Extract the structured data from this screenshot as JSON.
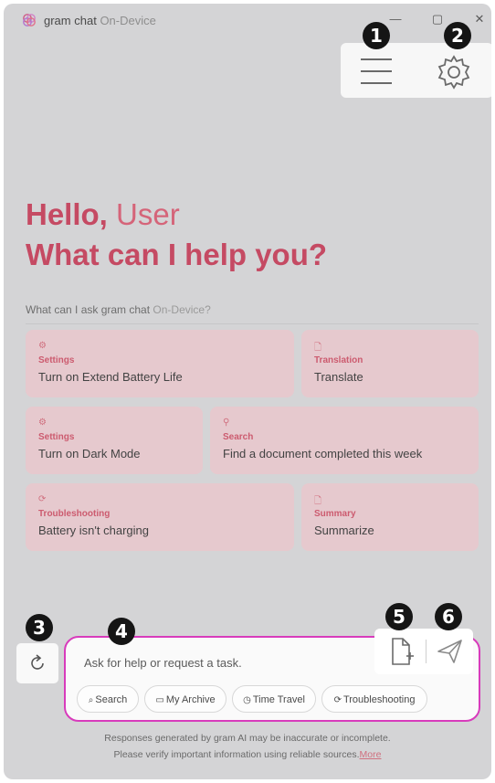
{
  "titlebar": {
    "app_name": "gram chat",
    "app_sub": "On-Device",
    "minimize": "—",
    "maximize": "▢",
    "close": "✕"
  },
  "callouts": [
    "1",
    "2",
    "3",
    "4",
    "5",
    "6"
  ],
  "greeting": {
    "hello": "Hello,",
    "user": "User",
    "question": "What can I help you?"
  },
  "ask": {
    "label": "What can I ask gram chat",
    "label_sub": "On-Device?"
  },
  "cards": [
    {
      "icon": "gear-icon",
      "category": "Settings",
      "text": "Turn on Extend Battery Life"
    },
    {
      "icon": "document-icon",
      "category": "Translation",
      "text": "Translate"
    },
    {
      "icon": "gear-icon",
      "category": "Settings",
      "text": "Turn on Dark Mode"
    },
    {
      "icon": "search-icon",
      "category": "Search",
      "text": "Find a document completed this week"
    },
    {
      "icon": "troubleshoot-icon",
      "category": "Troubleshooting",
      "text": "Battery isn't charging"
    },
    {
      "icon": "document-icon",
      "category": "Summary",
      "text": "Summarize"
    }
  ],
  "input": {
    "placeholder": "Ask for help or request a task."
  },
  "chips": [
    {
      "icon": "search-doc-icon",
      "label": "Search"
    },
    {
      "icon": "folder-icon",
      "label": "My Archive"
    },
    {
      "icon": "history-icon",
      "label": "Time Travel"
    },
    {
      "icon": "troubleshoot-icon",
      "label": "Troubleshooting"
    }
  ],
  "disclaimer": {
    "line1": "Responses generated by gram AI may be inaccurate or incomplete.",
    "line2": "Please verify important information using reliable sources.",
    "more": "More"
  },
  "colors": {
    "accent": "#c54a63",
    "card_bg": "#e6c9ce",
    "input_border": "#d83bbc"
  }
}
